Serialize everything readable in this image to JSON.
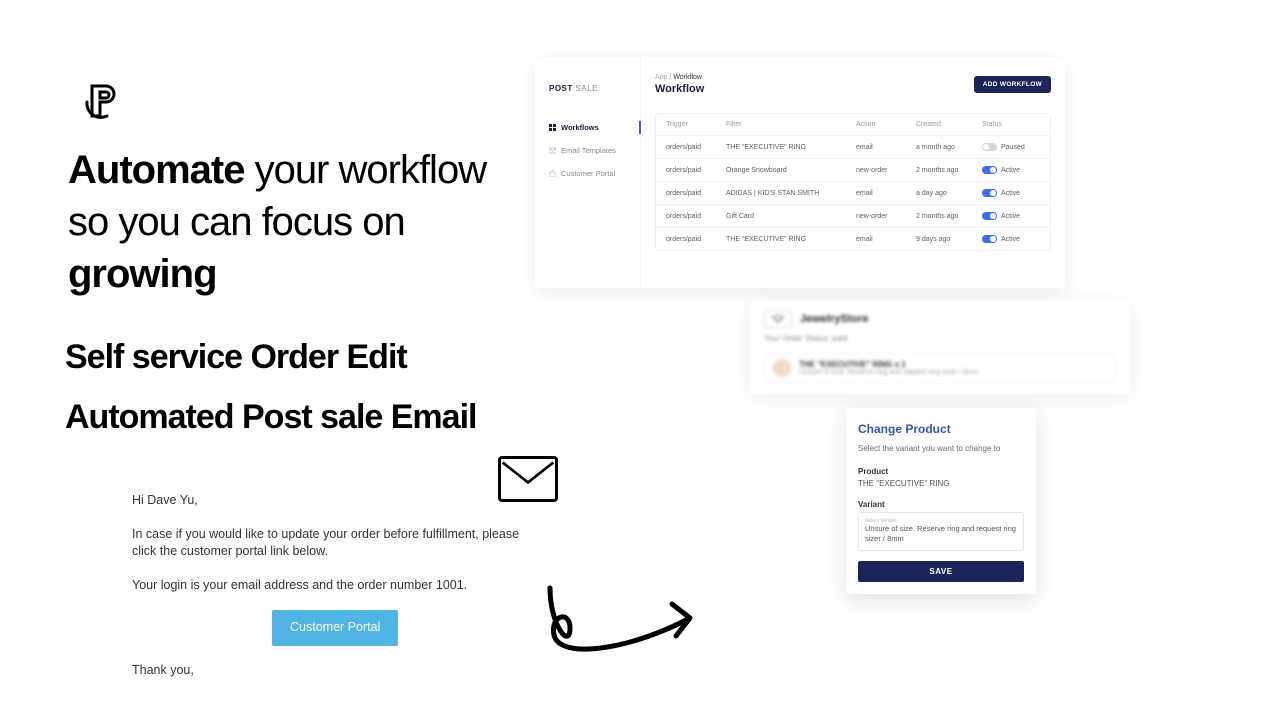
{
  "headline": {
    "pre": "Automate",
    "mid": " your workflow so you can focus on ",
    "post": "growing"
  },
  "sub1": "Self service Order Edit",
  "sub2": "Automated Post sale Email",
  "email": {
    "greeting": "Hi Dave Yu,",
    "body": "In case if you would like to update your order before fulfillment, please click the customer portal link below.",
    "login": "Your login is your email address and the order number 1001.",
    "cta": "Customer Portal",
    "thanks": "Thank you,"
  },
  "app": {
    "brand_bold": "POST",
    "brand_light": "SALE",
    "nav": [
      "Workflows",
      "Email Templates",
      "Customer Portal"
    ],
    "breadcrumb": {
      "root": "App",
      "page": "Workflow"
    },
    "title": "Workflow",
    "add": "ADD WORKFLOW",
    "cols": [
      "Trigger",
      "Filter",
      "Action",
      "Created",
      "Status"
    ],
    "rows": [
      {
        "trigger": "orders/paid",
        "filter": "THE \"EXECUTIVE\" RING",
        "action": "email",
        "created": "a month ago",
        "status": "Paused",
        "on": false
      },
      {
        "trigger": "orders/paid",
        "filter": "Orange Snowboard",
        "action": "new-order",
        "created": "2 months ago",
        "status": "Active",
        "on": true
      },
      {
        "trigger": "orders/paid",
        "filter": "ADIDAS | KID'S STAN SMITH",
        "action": "email",
        "created": "a day ago",
        "status": "Active",
        "on": true
      },
      {
        "trigger": "orders/paid",
        "filter": "Gift Card",
        "action": "new-order",
        "created": "2 months ago",
        "status": "Active",
        "on": true
      },
      {
        "trigger": "orders/paid",
        "filter": "THE \"EXECUTIVE\" RING",
        "action": "email",
        "created": "9 days ago",
        "status": "Active",
        "on": true
      }
    ]
  },
  "order_card": {
    "store": "JewelryStore",
    "status_line": "Your Order Status: paid",
    "product_title": "THE \"EXECUTIVE\" RING x 1",
    "product_sub": "Unsure of size. Reserve ring and request ring sizer / 8mm"
  },
  "change_product": {
    "title": "Change Product",
    "desc": "Select the variant you want to change to",
    "product_label": "Product",
    "product_value": "THE \"EXECUTIVE\" RING",
    "variant_label": "Variant",
    "variant_tiny": "Select Variant",
    "variant_value": "Unsure of size. Reserve ring and request ring sizer / 8mm",
    "save": "SAVE"
  }
}
